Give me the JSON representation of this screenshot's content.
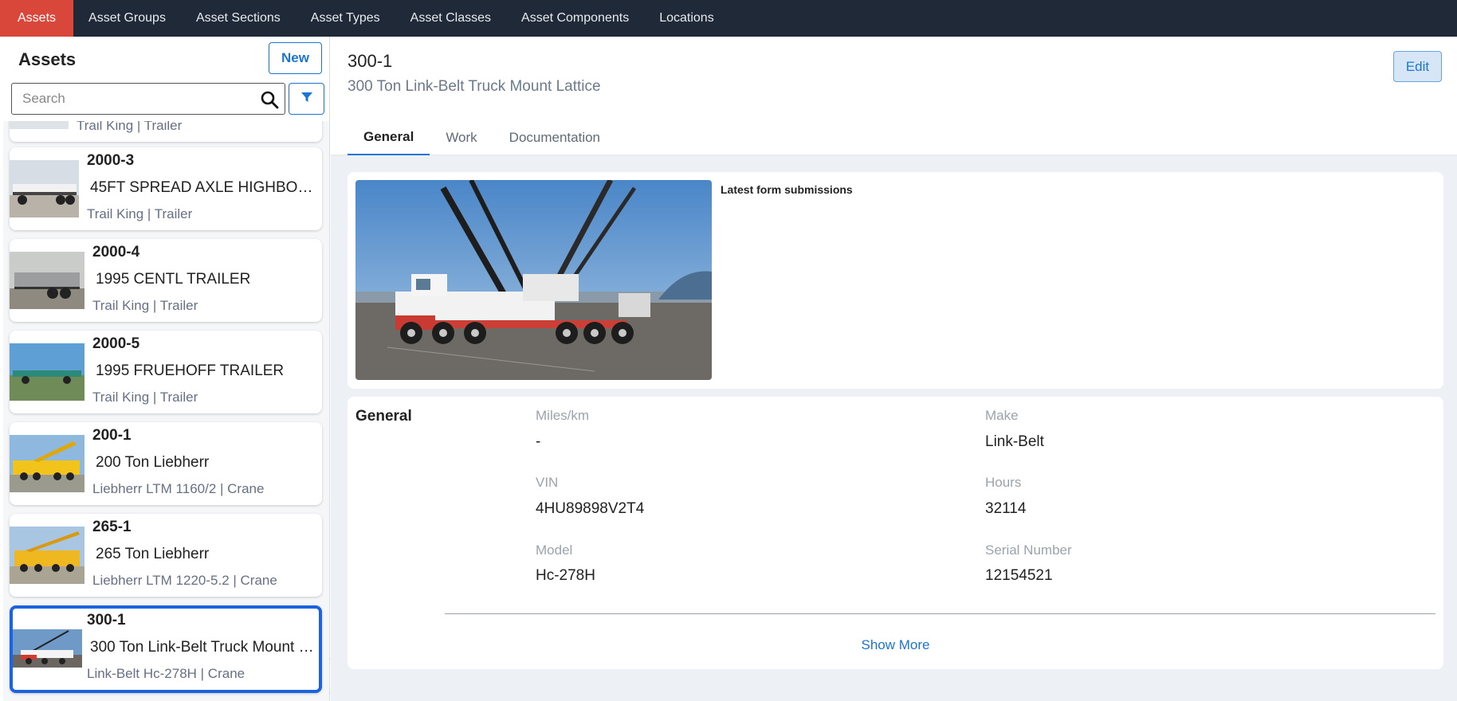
{
  "nav": {
    "tabs": [
      "Assets",
      "Asset Groups",
      "Asset Sections",
      "Asset Types",
      "Asset Classes",
      "Asset Components",
      "Locations"
    ],
    "active_index": 0,
    "active_color": "#d9473a"
  },
  "sidebar": {
    "title": "Assets",
    "new_label": "New",
    "search_placeholder": "Search",
    "assets": [
      {
        "id": "",
        "name": "",
        "meta": "Trail King | Trailer"
      },
      {
        "id": "2000-3",
        "name": "45FT SPREAD AXLE HIGHBOY TRAILER",
        "meta": "Trail King | Trailer"
      },
      {
        "id": "2000-4",
        "name": "1995 CENTL TRAILER",
        "meta": "Trail King | Trailer"
      },
      {
        "id": "2000-5",
        "name": "1995 FRUEHOFF TRAILER",
        "meta": "Trail King | Trailer"
      },
      {
        "id": "200-1",
        "name": "200 Ton Liebherr",
        "meta": "Liebherr LTM 1160/2 | Crane"
      },
      {
        "id": "265-1",
        "name": "265 Ton Liebherr",
        "meta": "Liebherr LTM 1220-5.2 | Crane"
      },
      {
        "id": "300-1",
        "name": "300 Ton Link-Belt Truck Mount Lattice",
        "meta": "Link-Belt Hc-278H | Crane"
      }
    ],
    "selected_index": 6
  },
  "main": {
    "title": "300-1",
    "subtitle": "300 Ton Link-Belt Truck Mount Lattice",
    "edit_label": "Edit",
    "tabs": [
      "General",
      "Work",
      "Documentation"
    ],
    "active_tab_index": 0,
    "forms_title": "Latest form submissions",
    "general": {
      "title": "General",
      "fields": [
        {
          "label": "Miles/km",
          "value": "-"
        },
        {
          "label": "Make",
          "value": "Link-Belt"
        },
        {
          "label": "VIN",
          "value": "4HU89898V2T4"
        },
        {
          "label": "Hours",
          "value": "32114"
        },
        {
          "label": "Model",
          "value": "Hc-278H"
        },
        {
          "label": "Serial Number",
          "value": "12154521"
        }
      ],
      "show_more_label": "Show More"
    }
  },
  "icons": {
    "search": "search-icon",
    "filter": "filter-icon",
    "collapse": "chevron-left-icon"
  },
  "colors": {
    "accent": "#1b76d2",
    "selected_border": "#1b63e0",
    "topbar": "#1f2937"
  }
}
